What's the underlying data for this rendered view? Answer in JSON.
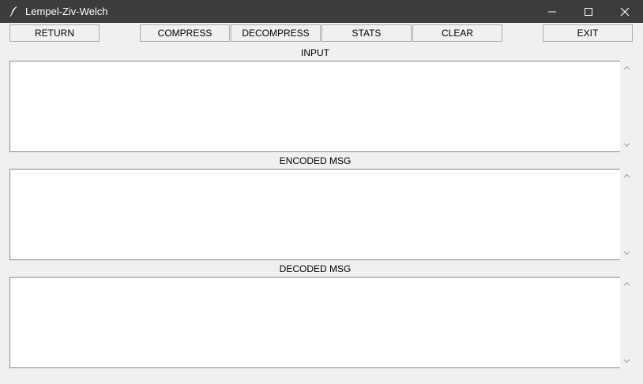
{
  "window": {
    "title": "Lempel-Ziv-Welch",
    "controls": [
      "minimize-icon",
      "maximize-icon",
      "close-icon"
    ]
  },
  "toolbar": {
    "return_label": "RETURN",
    "compress_label": "COMPRESS",
    "decompress_label": "DECOMPRESS",
    "stats_label": "STATS",
    "clear_label": "CLEAR",
    "exit_label": "EXIT"
  },
  "sections": {
    "input_label": "INPUT",
    "encoded_label": "ENCODED MSG",
    "decoded_label": "DECODED MSG"
  },
  "fields": {
    "input_text": "",
    "encoded_text": "",
    "decoded_text": ""
  },
  "colors": {
    "titlebar": "#3c3c3c",
    "background": "#f0f0f0",
    "text_area": "#ffffff",
    "border": "#adadad"
  }
}
